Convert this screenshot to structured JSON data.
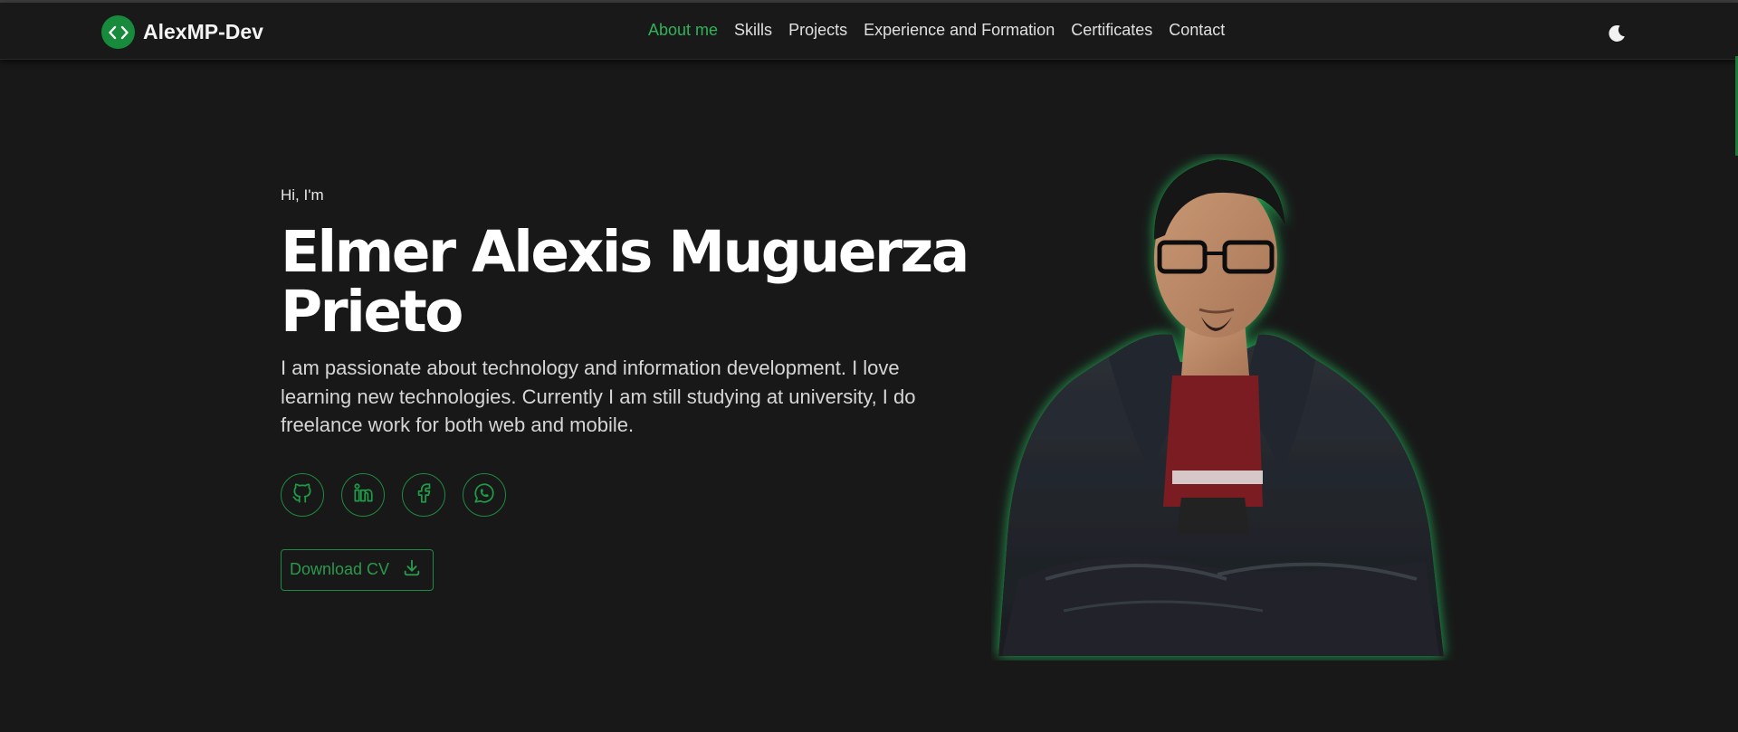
{
  "header": {
    "brand": "AlexMP-Dev",
    "nav": [
      {
        "label": "About me",
        "active": true
      },
      {
        "label": "Skills"
      },
      {
        "label": "Projects"
      },
      {
        "label": "Experience and Formation"
      },
      {
        "label": "Certificates"
      },
      {
        "label": "Contact"
      }
    ],
    "theme_icon": "moon-icon"
  },
  "hero": {
    "greeting": "Hi, I'm",
    "name": "Elmer Alexis Muguerza Prieto",
    "description": "I am passionate about technology and information development. I love learning new technologies. Currently I am still studying at university, I do freelance work for both web and mobile.",
    "socials": [
      "github-icon",
      "linkedin-icon",
      "facebook-icon",
      "whatsapp-icon"
    ],
    "cv_label": "Download CV",
    "cv_icon": "download-icon"
  },
  "colors": {
    "accent": "#2fb35a",
    "background": "#181818",
    "navbar": "#191919",
    "brand_badge": "#178a3b"
  }
}
